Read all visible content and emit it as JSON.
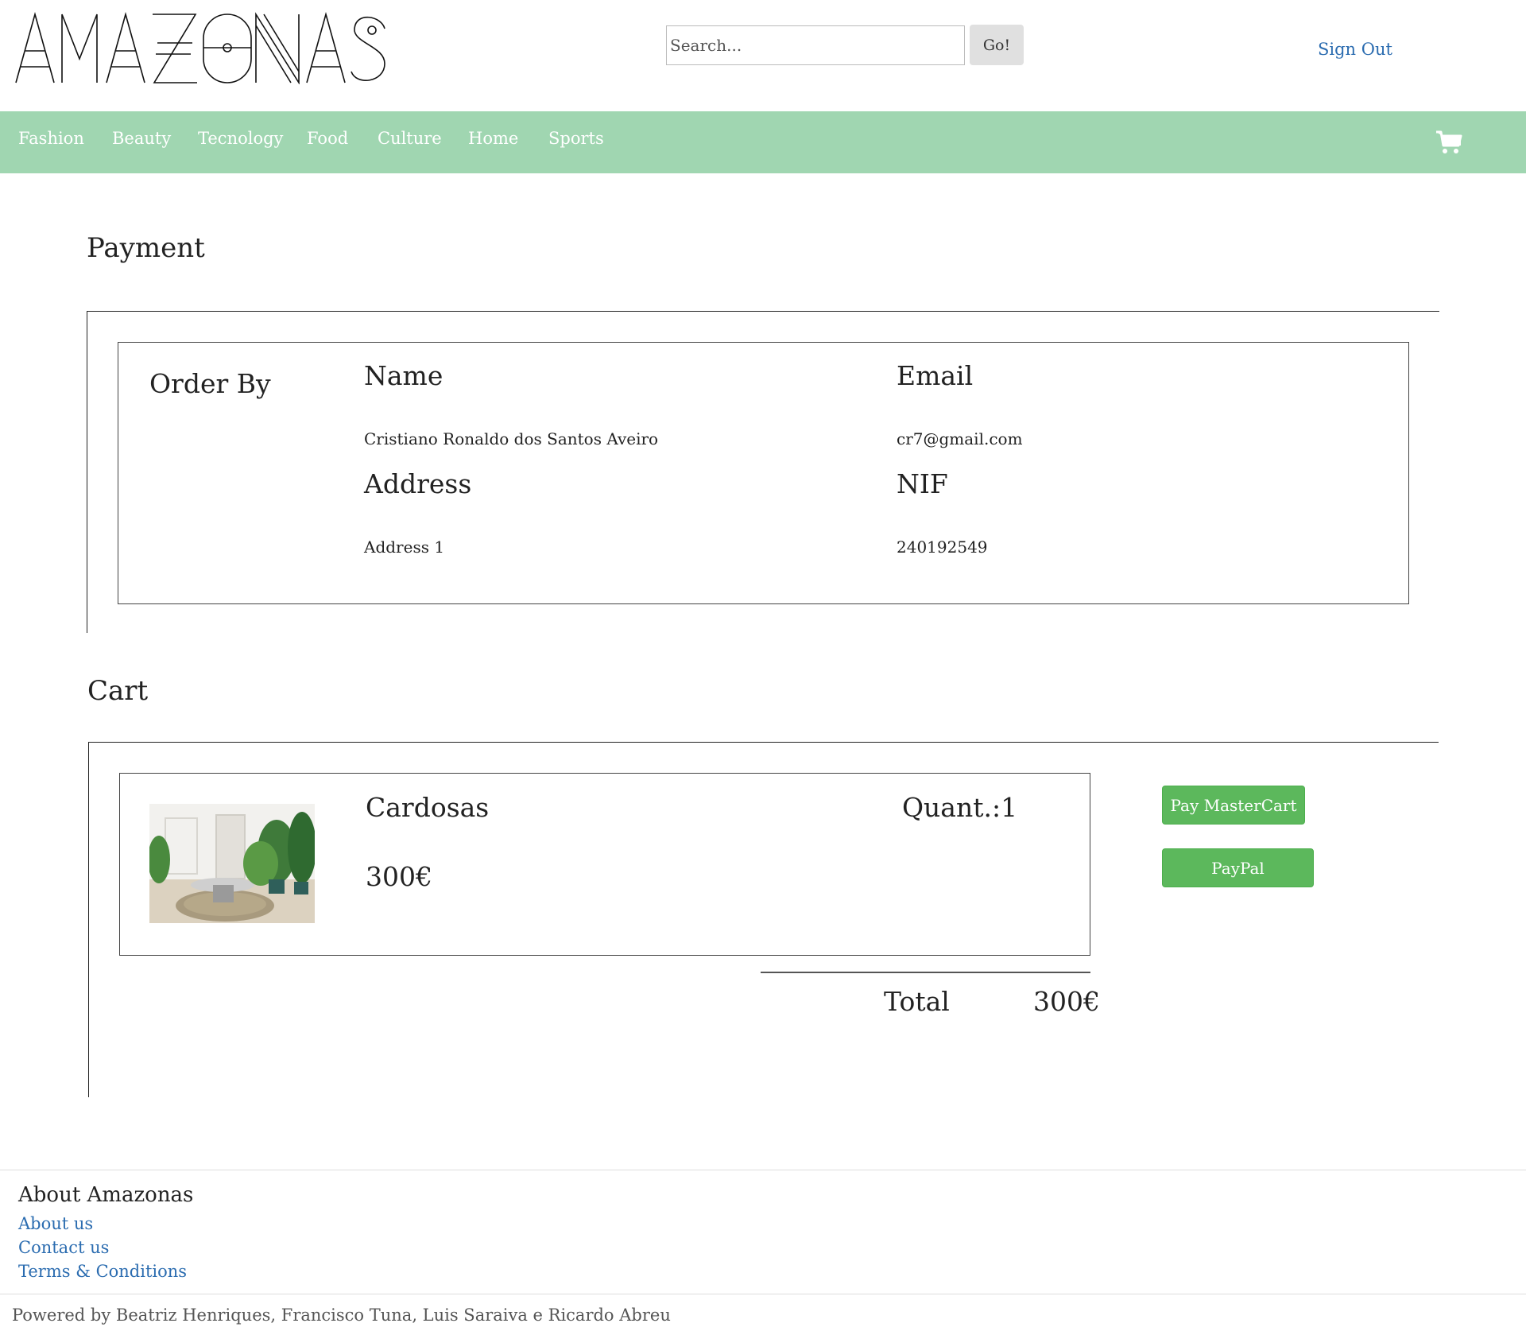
{
  "header": {
    "logo_text": "AMAZONAS",
    "search": {
      "placeholder": "Search...",
      "value": ""
    },
    "go_label": "Go!",
    "signout_label": "Sign Out"
  },
  "nav": {
    "items": [
      "Fashion",
      "Beauty",
      "Tecnology",
      "Food",
      "Culture",
      "Home",
      "Sports"
    ],
    "cart_icon": "shopping-cart-icon"
  },
  "payment": {
    "title": "Payment",
    "order_by_label": "Order By",
    "name_label": "Name",
    "name_value": "Cristiano Ronaldo dos Santos Aveiro",
    "email_label": "Email",
    "email_value": "cr7@gmail.com",
    "address_label": "Address",
    "address_value": "Address 1",
    "nif_label": "NIF",
    "nif_value": "240192549"
  },
  "cart": {
    "title": "Cart",
    "item": {
      "name": "Cardosas",
      "price": "300€",
      "quantity": "Quant.:1"
    },
    "total_label": "Total",
    "total_value": "300€",
    "pay_mastercard_label": "Pay MasterCart",
    "paypal_label": "PayPal"
  },
  "footer": {
    "about_title": "About Amazonas",
    "links": [
      "About us",
      "Contact us",
      "Terms & Conditions"
    ],
    "powered_by": "Powered by Beatriz Henriques, Francisco Tuna, Luis Saraiva e Ricardo Abreu"
  },
  "colors": {
    "navbar": "#a0d6b1",
    "link": "#2b6cb0",
    "button_green": "#5cb85c"
  }
}
